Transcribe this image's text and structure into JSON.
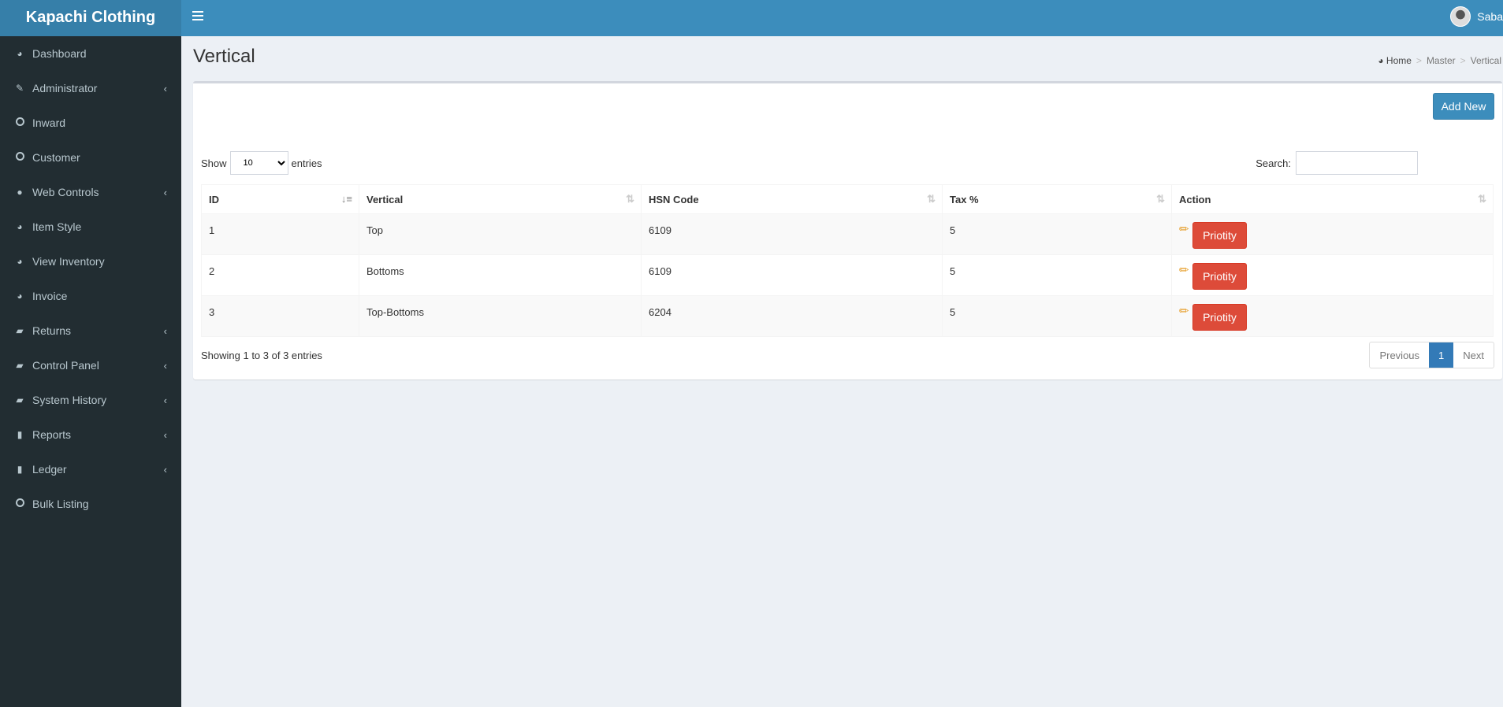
{
  "app": {
    "title": "Kapachi Clothing",
    "user": "Saba"
  },
  "sidebar": {
    "items": [
      {
        "label": "Dashboard",
        "icon": "dashboard-icon",
        "chev": false
      },
      {
        "label": "Administrator",
        "icon": "edit-icon",
        "chev": true
      },
      {
        "label": "Inward",
        "icon": "circle-icon",
        "chev": false
      },
      {
        "label": "Customer",
        "icon": "circle-icon",
        "chev": false
      },
      {
        "label": "Web Controls",
        "icon": "globe-icon",
        "chev": true
      },
      {
        "label": "Item Style",
        "icon": "dashboard-icon",
        "chev": false
      },
      {
        "label": "View Inventory",
        "icon": "dashboard-icon",
        "chev": false
      },
      {
        "label": "Invoice",
        "icon": "dashboard-icon",
        "chev": false
      },
      {
        "label": "Returns",
        "icon": "book-icon",
        "chev": true
      },
      {
        "label": "Control Panel",
        "icon": "book-icon",
        "chev": true
      },
      {
        "label": "System History",
        "icon": "book-icon",
        "chev": true
      },
      {
        "label": "Reports",
        "icon": "file-icon",
        "chev": true
      },
      {
        "label": "Ledger",
        "icon": "file-icon",
        "chev": true
      },
      {
        "label": "Bulk Listing",
        "icon": "circle-icon",
        "chev": false
      }
    ]
  },
  "page": {
    "title": "Vertical",
    "breadcrumb": [
      "Home",
      "Master",
      "Vertical"
    ]
  },
  "toolbar": {
    "add_new": "Add New",
    "show": "Show",
    "entries": "entries",
    "page_size": "10",
    "search_label": "Search:",
    "search_value": ""
  },
  "table": {
    "headers": [
      "ID",
      "Vertical",
      "HSN Code",
      "Tax %",
      "Action"
    ],
    "rows": [
      {
        "id": "1",
        "vertical": "Top",
        "hsn": "6109",
        "tax": "5",
        "action": "Priotity"
      },
      {
        "id": "2",
        "vertical": "Bottoms",
        "hsn": "6109",
        "tax": "5",
        "action": "Priotity"
      },
      {
        "id": "3",
        "vertical": "Top-Bottoms",
        "hsn": "6204",
        "tax": "5",
        "action": "Priotity"
      }
    ]
  },
  "footer": {
    "info": "Showing 1 to 3 of 3 entries",
    "previous": "Previous",
    "page": "1",
    "next": "Next"
  }
}
